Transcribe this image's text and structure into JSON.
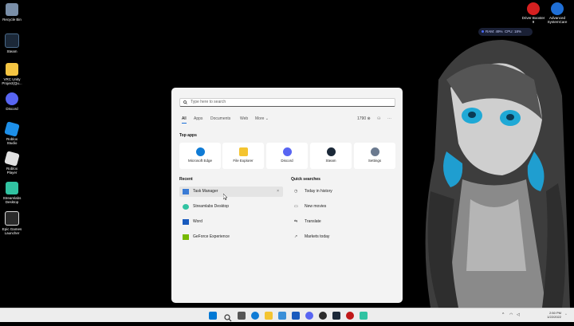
{
  "desktop": {
    "icons": [
      {
        "label": "Recycle Bin",
        "icon": "recycle-bin-icon",
        "color": "#7a8fa8"
      },
      {
        "label": "Steam",
        "icon": "steam-icon",
        "color": "#1b2838"
      },
      {
        "label": "VRC Unity Project(Qu...",
        "icon": "folder-icon",
        "color": "#f5c542"
      },
      {
        "label": "Discord",
        "icon": "discord-icon",
        "color": "#5865f2"
      },
      {
        "label": "Roblox Studio",
        "icon": "roblox-studio-icon",
        "color": "#1d8fe8"
      },
      {
        "label": "Roblox Player",
        "icon": "roblox-player-icon",
        "color": "#e0e0e0"
      },
      {
        "label": "Streamlabs Desktop",
        "icon": "streamlabs-icon",
        "color": "#31c3a2"
      },
      {
        "label": "Epic Games Launcher",
        "icon": "epic-games-icon",
        "color": "#2a2a2a"
      }
    ],
    "right_icons": [
      {
        "label": "Driver Booster 9",
        "icon": "driver-booster-icon",
        "color": "#d62020"
      },
      {
        "label": "Advanced SystemCare",
        "icon": "advanced-systemcare-icon",
        "color": "#1f6fd6"
      }
    ],
    "perf_widget": {
      "ram": "RAM: 49%",
      "cpu": "CPU: 18%"
    }
  },
  "start": {
    "search_placeholder": "Type here to search",
    "tabs": [
      {
        "label": "All",
        "active": true
      },
      {
        "label": "Apps"
      },
      {
        "label": "Documents"
      },
      {
        "label": "Web"
      },
      {
        "label": "More"
      }
    ],
    "points": "1790",
    "top_apps_title": "Top apps",
    "top_apps": [
      {
        "label": "Microsoft Edge",
        "icon": "edge-icon",
        "color": "#0f7bd5"
      },
      {
        "label": "File Explorer",
        "icon": "file-explorer-icon",
        "color": "#f4c430"
      },
      {
        "label": "Discord",
        "icon": "discord-icon",
        "color": "#5865f2"
      },
      {
        "label": "Steam",
        "icon": "steam-icon",
        "color": "#1b2838"
      },
      {
        "label": "Settings",
        "icon": "settings-icon",
        "color": "#6b7a8f"
      }
    ],
    "recent_title": "Recent",
    "recent": [
      {
        "label": "Task Manager",
        "icon": "task-manager-icon",
        "color": "#3a7bd5"
      },
      {
        "label": "Streamlabs Desktop",
        "icon": "streamlabs-icon",
        "color": "#31c3a2"
      },
      {
        "label": "Word",
        "icon": "word-icon",
        "color": "#185abd"
      },
      {
        "label": "GeForce Experience",
        "icon": "geforce-icon",
        "color": "#76b900"
      }
    ],
    "quick_title": "Quick searches",
    "quick": [
      {
        "label": "Today in history",
        "icon": "clock-icon"
      },
      {
        "label": "New movies",
        "icon": "movie-icon"
      },
      {
        "label": "Translate",
        "icon": "translate-icon"
      },
      {
        "label": "Markets today",
        "icon": "chart-icon"
      }
    ]
  },
  "taskbar": {
    "time": "2:50 PM",
    "date": "1/22/2022",
    "apps": [
      {
        "icon": "windows-start-icon",
        "color": "#0078d4"
      },
      {
        "icon": "search-icon",
        "color": "#333333"
      },
      {
        "icon": "task-view-icon",
        "color": "#555555"
      },
      {
        "icon": "edge-icon",
        "color": "#0f7bd5"
      },
      {
        "icon": "file-explorer-icon",
        "color": "#f4c430"
      },
      {
        "icon": "store-icon",
        "color": "#3a8fd8"
      },
      {
        "icon": "word-icon",
        "color": "#185abd"
      },
      {
        "icon": "discord-icon",
        "color": "#5865f2"
      },
      {
        "icon": "obs-icon",
        "color": "#2b2b2b"
      },
      {
        "icon": "steam-icon",
        "color": "#1b2838"
      },
      {
        "icon": "record-icon",
        "color": "#c01818"
      },
      {
        "icon": "streamlabs-icon",
        "color": "#31c3a2"
      }
    ]
  }
}
